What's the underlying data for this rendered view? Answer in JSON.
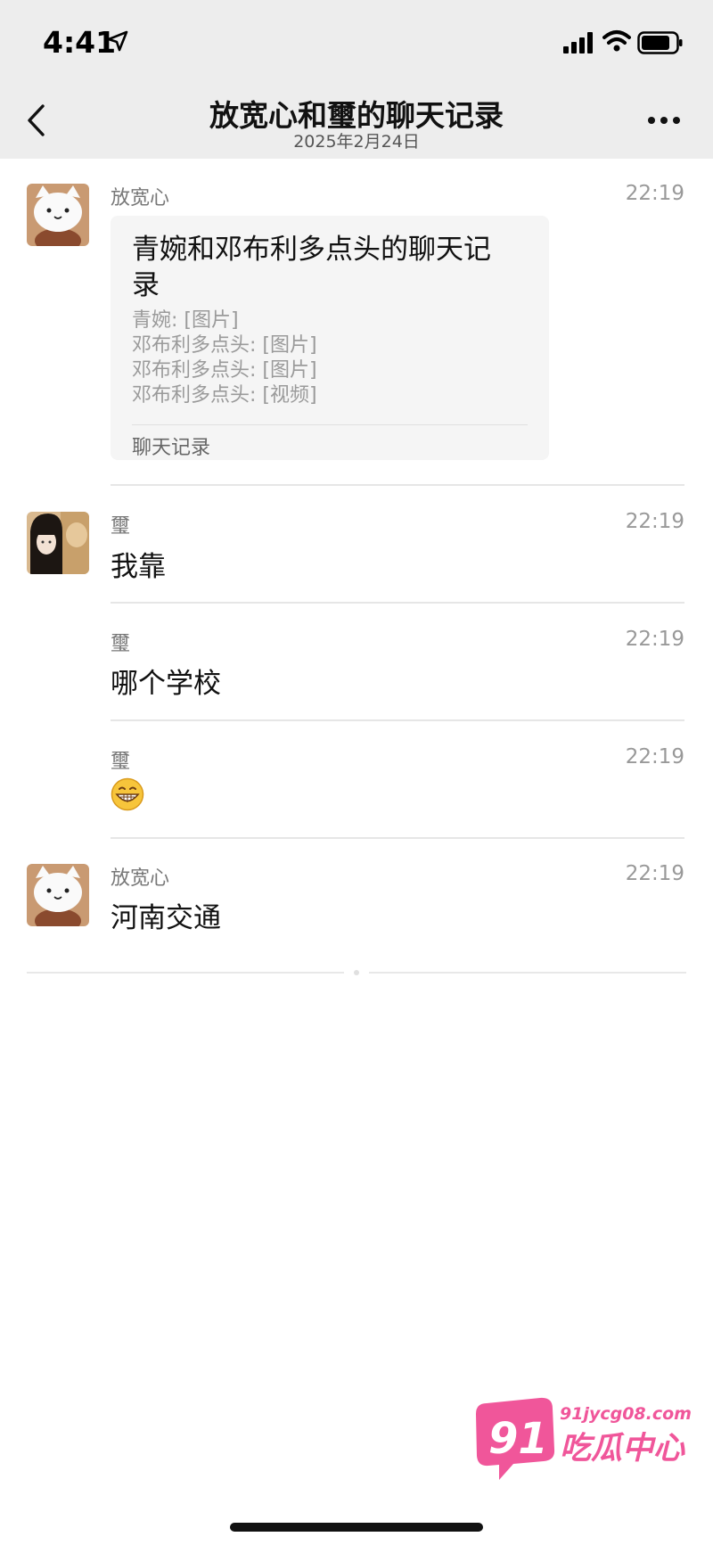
{
  "status_bar": {
    "time": "4:41",
    "icons": [
      "location-arrow-icon",
      "cellular-signal-icon",
      "wifi-icon",
      "battery-icon"
    ]
  },
  "nav": {
    "title": "放宽心和璽的聊天记录",
    "subtitle": "2025年2月24日",
    "icons": [
      "back-chevron-icon",
      "more-icon"
    ]
  },
  "messages": [
    {
      "sender": "放宽心",
      "time": "22:19",
      "type": "chat-record-card",
      "card": {
        "title": "青婉和邓布利多点头的聊天记录",
        "lines": [
          "青婉: [图片]",
          "邓布利多点头: [图片]",
          "邓布利多点头: [图片]",
          "邓布利多点头: [视频]"
        ],
        "footer": "聊天记录"
      }
    },
    {
      "sender": "璽",
      "time": "22:19",
      "text": "我靠"
    },
    {
      "sender": "璽",
      "time": "22:19",
      "text": "哪个学校"
    },
    {
      "sender": "璽",
      "time": "22:19",
      "emoji": "grinning-face-icon"
    },
    {
      "sender": "放宽心",
      "time": "22:19",
      "text": "河南交通"
    }
  ],
  "watermark": {
    "logo_number": "91",
    "domain": "91jycg08.com",
    "name": "吃瓜中心"
  },
  "colors": {
    "header_bg": "#ededed",
    "card_bg": "#f5f5f5",
    "watermark_pink": "#f0569a"
  }
}
